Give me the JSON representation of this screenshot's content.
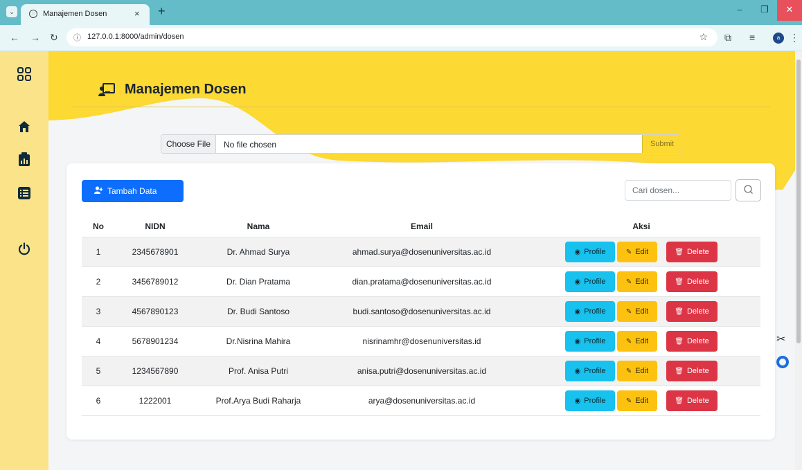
{
  "browser": {
    "tab_title": "Manajemen Dosen",
    "tab_close": "×",
    "new_tab": "+",
    "url": "127.0.0.1:8000/admin/dosen",
    "profile_letter": "a"
  },
  "page": {
    "title": "Manajemen Dosen",
    "file_button": "Choose File",
    "file_status": "No file chosen",
    "submit_label": "Submit",
    "add_label": "Tambah Data",
    "search_placeholder": "Cari dosen...",
    "columns": [
      "No",
      "NIDN",
      "Nama",
      "Email",
      "Aksi"
    ],
    "actions": {
      "profile": "Profile",
      "edit": "Edit",
      "delete": "Delete"
    },
    "rows": [
      {
        "no": "1",
        "nidn": "2345678901",
        "nama": "Dr. Ahmad Surya",
        "email": "ahmad.surya@dosenuniversitas.ac.id"
      },
      {
        "no": "2",
        "nidn": "3456789012",
        "nama": "Dr. Dian Pratama",
        "email": "dian.pratama@dosenuniversitas.ac.id"
      },
      {
        "no": "3",
        "nidn": "4567890123",
        "nama": "Dr. Budi Santoso",
        "email": "budi.santoso@dosenuniversitas.ac.id"
      },
      {
        "no": "4",
        "nidn": "5678901234",
        "nama": "Dr.Nisrina Mahira",
        "email": "nisrinamhr@dosenuniversitas.id"
      },
      {
        "no": "5",
        "nidn": "1234567890",
        "nama": "Prof. Anisa Putri",
        "email": "anisa.putri@dosenuniversitas.ac.id"
      },
      {
        "no": "6",
        "nidn": "1222001",
        "nama": "Prof.Arya Budi Raharja",
        "email": "arya@dosenuniversitas.ac.id"
      }
    ]
  },
  "colors": {
    "hero": "#fcd933",
    "sidebar": "#fbe38a",
    "primary": "#0d6efd",
    "info": "#18c1ee",
    "warning": "#fcc20f",
    "danger": "#dc3545",
    "browser_frame": "#63bcc8"
  },
  "icons": {
    "sidebar": [
      "grid-icon",
      "home-icon",
      "clipboard-chart-icon",
      "list-icon",
      "power-icon"
    ],
    "title": "chalkboard-teacher-icon",
    "add": "user-plus-icon",
    "search": "search-icon",
    "profile": "eye-icon",
    "edit": "edit-icon",
    "delete": "trash-icon"
  }
}
